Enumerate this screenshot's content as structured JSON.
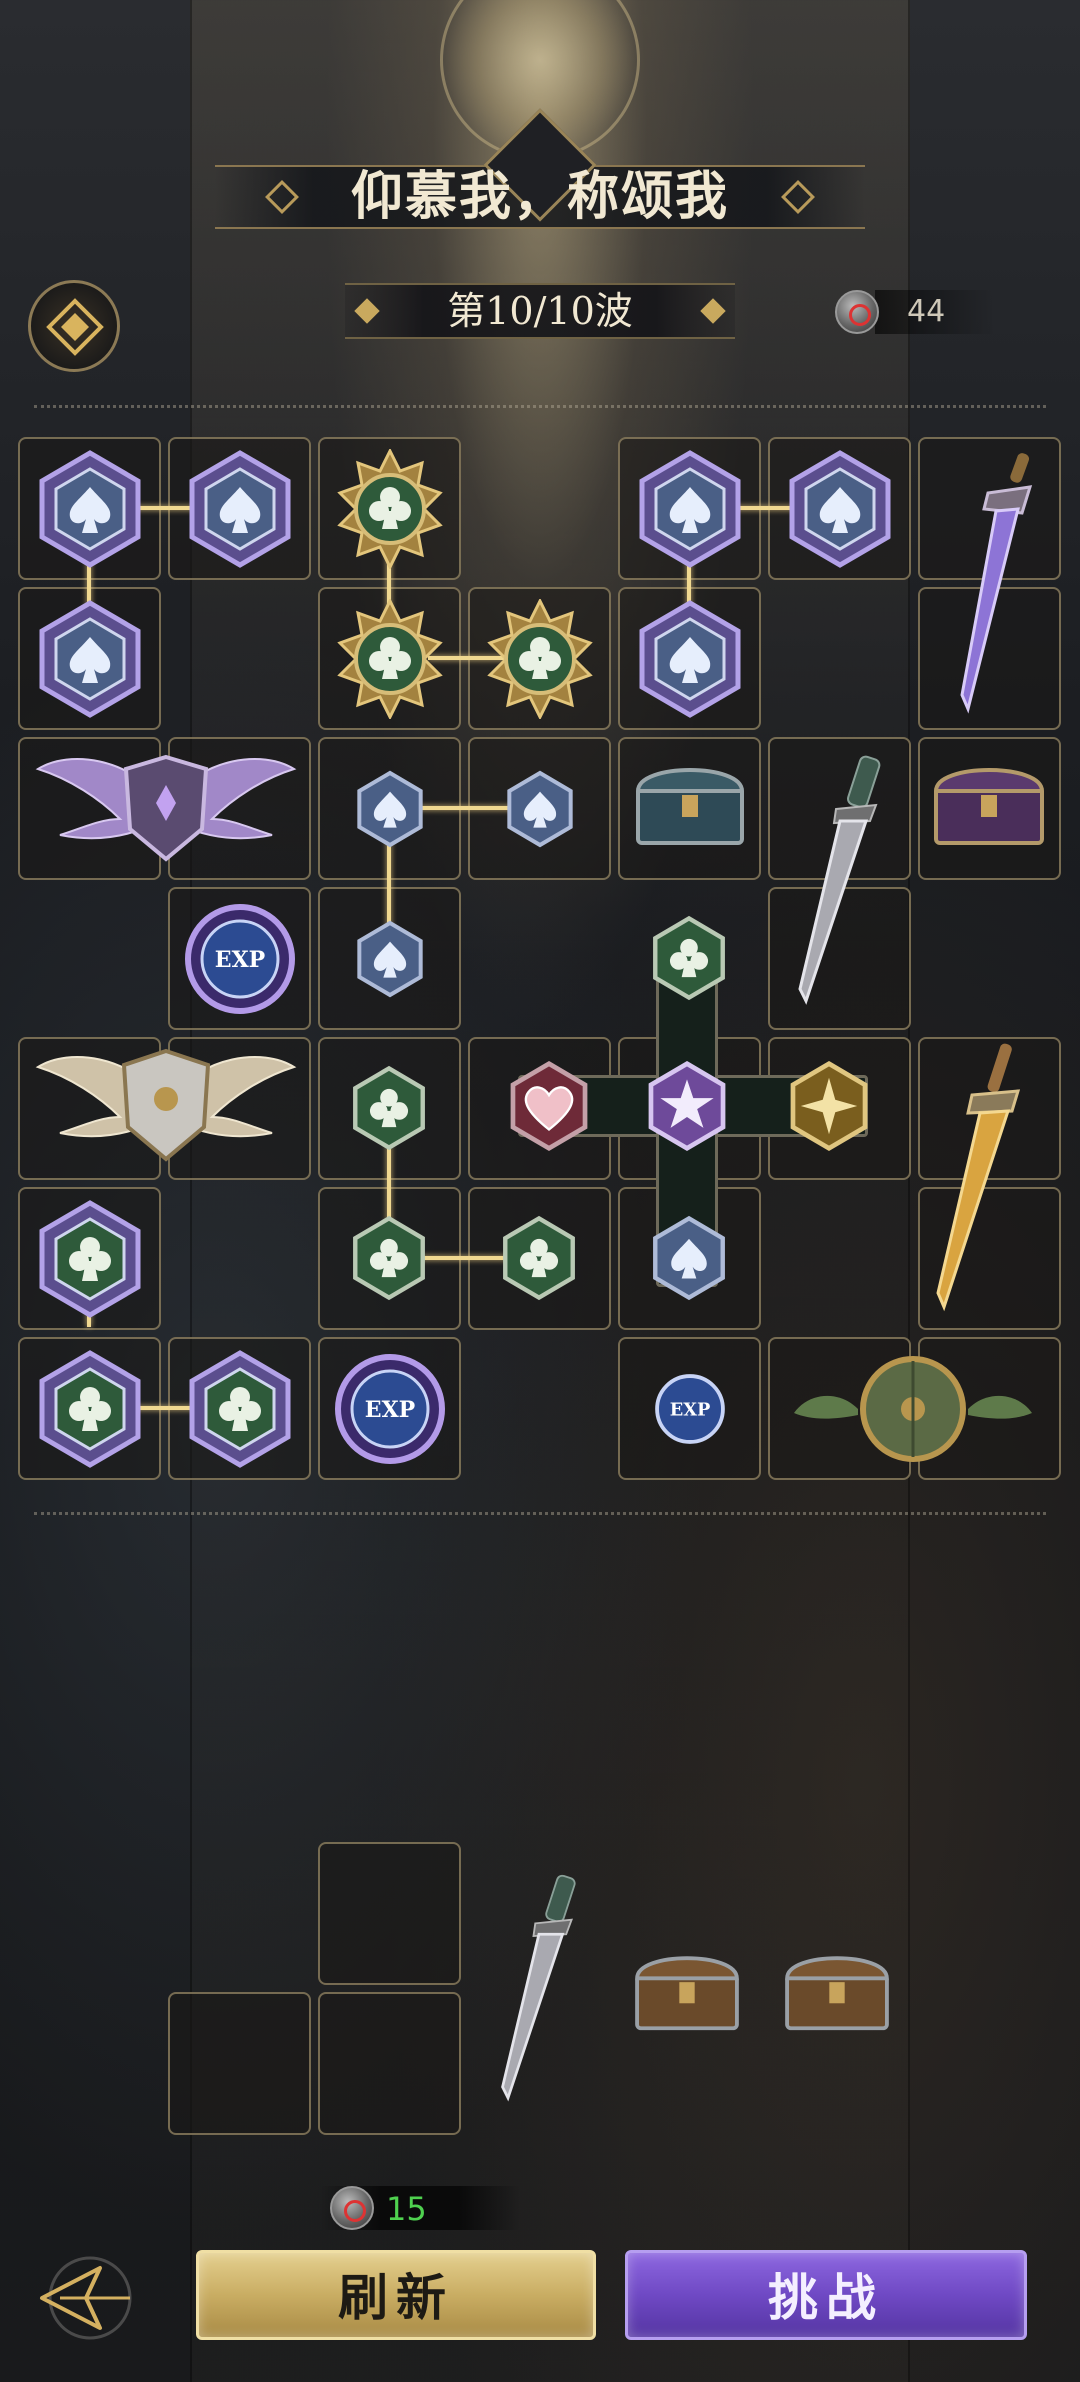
{
  "header": {
    "title": "仰慕我，称颂我",
    "wave": "第10/10波",
    "currency_value": "44"
  },
  "board": {
    "gem_types": [
      "spade",
      "club",
      "heart",
      "star",
      "diamond-star"
    ],
    "items": [
      "dagger-purple",
      "winged-shield-purple",
      "treasure-chest-teal",
      "treasure-chest-purple",
      "dagger-steel",
      "exp-orb",
      "winged-shield-silver",
      "dagger-gold",
      "round-shield"
    ],
    "exp_label": "EXP"
  },
  "footer": {
    "currency_value": "15",
    "refresh_label": "刷新",
    "challenge_label": "挑战"
  },
  "colors": {
    "spade_fill": "#4a5f86",
    "club_fill": "#2e5a3a",
    "gold_frame": "#c7a45c",
    "purple_frame": "#8c7ac9",
    "refresh_button": "#c9ad63",
    "challenge_button": "#6f49c4",
    "currency_green": "#4fd14f"
  }
}
